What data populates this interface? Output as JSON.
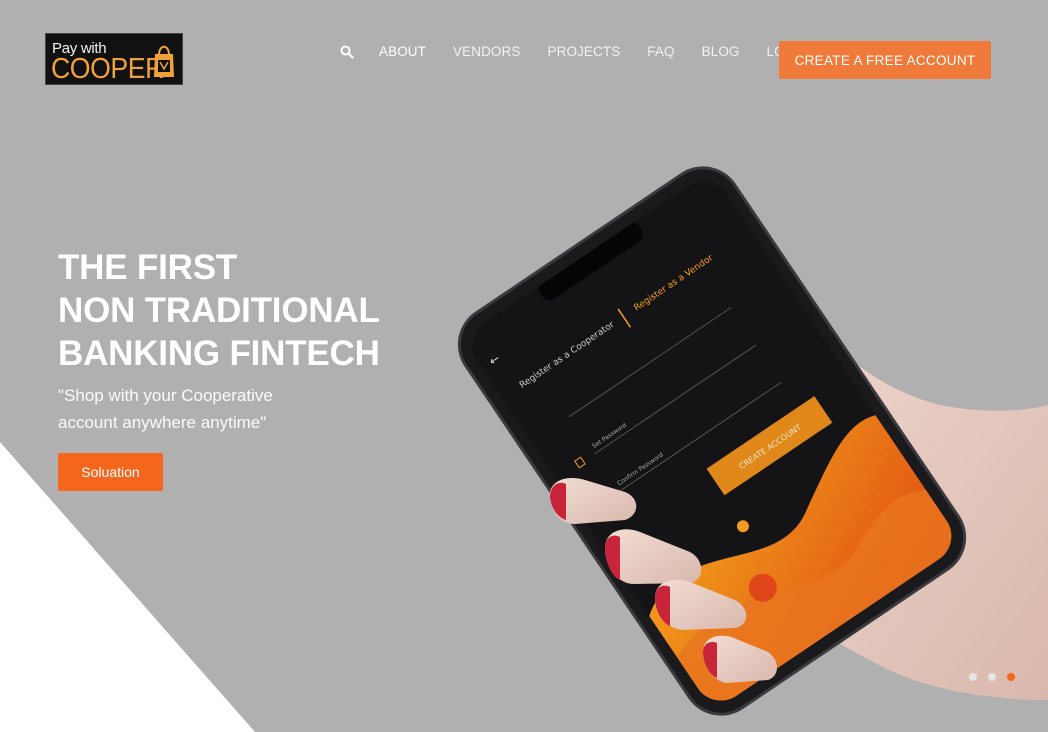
{
  "logo": {
    "line1": "Pay with",
    "line2": "COOPER"
  },
  "nav": {
    "search_icon": "search-icon",
    "items": [
      {
        "label": "ABOUT",
        "active": true
      },
      {
        "label": "VENDORS"
      },
      {
        "label": "PROJECTS"
      },
      {
        "label": "FAQ"
      },
      {
        "label": "BLOG"
      },
      {
        "label": "LOGIN"
      }
    ],
    "cta_label": "CREATE A FREE ACCOUNT"
  },
  "hero": {
    "title_lines": [
      "THE FIRST",
      "NON TRADITIONAL",
      "BANKING FINTECH"
    ],
    "subtitle_lines": [
      "\"Shop with your Cooperative",
      "account anywhere anytime\""
    ],
    "button_label": "Soluation"
  },
  "phone_screen": {
    "tab_cooperator": "Register as a Cooperator",
    "tab_vendor": "Register as a Vendor",
    "field_set_password": "Set Password",
    "field_confirm_password": "Confirm Password",
    "create_button": "CREATE ACCOUNT"
  },
  "carousel": {
    "slides": 3,
    "active_index": 2
  },
  "colors": {
    "accent": "#f4651d",
    "background": "#b0b0b0",
    "logo_gold": "#f0a23a"
  }
}
